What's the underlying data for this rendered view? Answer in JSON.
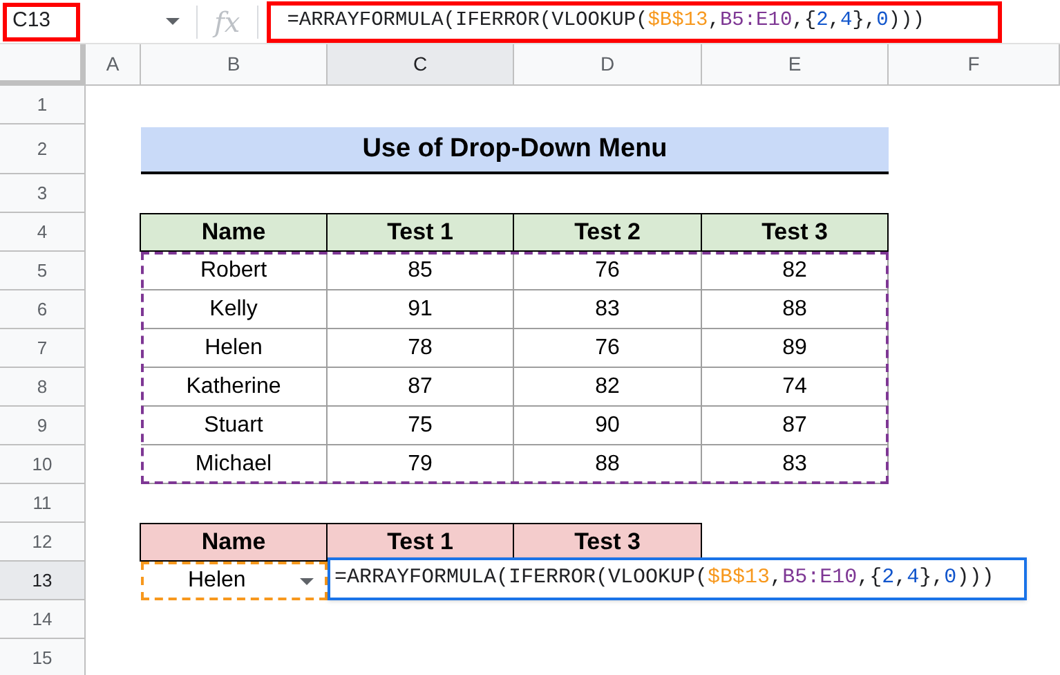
{
  "name_box": "C13",
  "fx": "fx",
  "formula_bar": [
    {
      "text": "=ARRAYFORMULA(IFERROR(VLOOKUP(",
      "color": "#202124"
    },
    {
      "text": "$B$13",
      "color": "#f7981d"
    },
    {
      "text": ",",
      "color": "#202124"
    },
    {
      "text": "B5:E10",
      "color": "#7e3794"
    },
    {
      "text": ",{",
      "color": "#202124"
    },
    {
      "text": "2",
      "color": "#1155cc"
    },
    {
      "text": ",",
      "color": "#202124"
    },
    {
      "text": "4",
      "color": "#1155cc"
    },
    {
      "text": "},",
      "color": "#202124"
    },
    {
      "text": "0",
      "color": "#1155cc"
    },
    {
      "text": ")))",
      "color": "#202124"
    }
  ],
  "columns": [
    {
      "label": "A",
      "selected": false
    },
    {
      "label": "B",
      "selected": false
    },
    {
      "label": "C",
      "selected": true
    },
    {
      "label": "D",
      "selected": false
    },
    {
      "label": "E",
      "selected": false
    },
    {
      "label": "F",
      "selected": false
    }
  ],
  "rows": [
    {
      "label": "1",
      "selected": false
    },
    {
      "label": "2",
      "selected": false
    },
    {
      "label": "3",
      "selected": false
    },
    {
      "label": "4",
      "selected": false
    },
    {
      "label": "5",
      "selected": false
    },
    {
      "label": "6",
      "selected": false
    },
    {
      "label": "7",
      "selected": false
    },
    {
      "label": "8",
      "selected": false
    },
    {
      "label": "9",
      "selected": false
    },
    {
      "label": "10",
      "selected": false
    },
    {
      "label": "11",
      "selected": false
    },
    {
      "label": "12",
      "selected": false
    },
    {
      "label": "13",
      "selected": true
    },
    {
      "label": "14",
      "selected": false
    },
    {
      "label": "15",
      "selected": false
    }
  ],
  "title": "Use of Drop-Down Menu",
  "table": {
    "columns": [
      "Name",
      "Test 1",
      "Test 2",
      "Test 3"
    ],
    "rows": [
      [
        "Robert",
        "85",
        "76",
        "82"
      ],
      [
        "Kelly",
        "91",
        "83",
        "88"
      ],
      [
        "Helen",
        "78",
        "76",
        "89"
      ],
      [
        "Katherine",
        "87",
        "82",
        "74"
      ],
      [
        "Stuart",
        "75",
        "90",
        "87"
      ],
      [
        "Michael",
        "79",
        "88",
        "83"
      ]
    ]
  },
  "lookup": {
    "columns": [
      "Name",
      "Test 1",
      "Test 3"
    ],
    "name": "Helen",
    "formula": [
      {
        "text": "=ARRAYFORMULA(IFERROR(VLOOKUP(",
        "color": "#202124"
      },
      {
        "text": "$B$13",
        "color": "#f7981d"
      },
      {
        "text": ",",
        "color": "#202124"
      },
      {
        "text": "B5:E10",
        "color": "#7e3794"
      },
      {
        "text": ",{",
        "color": "#202124"
      },
      {
        "text": "2",
        "color": "#1155cc"
      },
      {
        "text": ",",
        "color": "#202124"
      },
      {
        "text": "4",
        "color": "#1155cc"
      },
      {
        "text": "},",
        "color": "#202124"
      },
      {
        "text": "0",
        "color": "#1155cc"
      },
      {
        "text": ")))",
        "color": "#202124"
      }
    ]
  }
}
